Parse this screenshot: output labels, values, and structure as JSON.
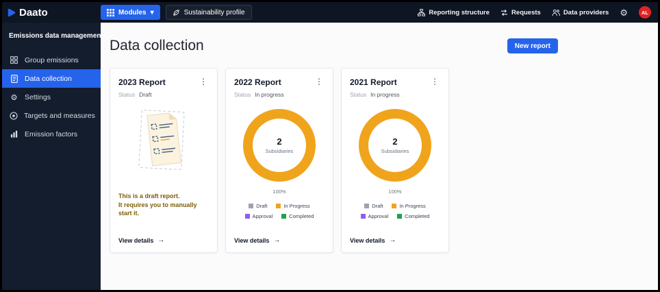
{
  "topbar": {
    "logo_text": "Daato",
    "modules_label": "Modules",
    "sustainability_label": "Sustainability profile",
    "nav": [
      {
        "label": "Reporting structure"
      },
      {
        "label": "Requests"
      },
      {
        "label": "Data providers"
      }
    ],
    "avatar_initials": "AL"
  },
  "sidebar": {
    "title": "Emissions data management",
    "items": [
      {
        "label": "Group emissions",
        "active": false
      },
      {
        "label": "Data collection",
        "active": true
      },
      {
        "label": "Settings",
        "active": false
      },
      {
        "label": "Targets and measures",
        "active": false
      },
      {
        "label": "Emission factors",
        "active": false
      }
    ]
  },
  "main": {
    "title": "Data collection",
    "new_report_label": "New report",
    "cards": [
      {
        "title": "2023 Report",
        "status_label": "Status",
        "status_value": "Draft",
        "message_line1": "This is a draft report.",
        "message_line2": "It requires you to manually start it.",
        "view_details_label": "View details"
      },
      {
        "title": "2022 Report",
        "status_label": "Status",
        "status_value": "In progress",
        "donut_count": "2",
        "donut_label": "Subsidiaries",
        "percent": "100%",
        "legend": [
          {
            "label": "Draft",
            "color": "#9ca3af"
          },
          {
            "label": "In Progress",
            "color": "#f0a41c"
          },
          {
            "label": "Approval",
            "color": "#8b5cf6"
          },
          {
            "label": "Completed",
            "color": "#21a04c"
          }
        ],
        "view_details_label": "View details"
      },
      {
        "title": "2021 Report",
        "status_label": "Status",
        "status_value": "In progress",
        "donut_count": "2",
        "donut_label": "Subsidiaries",
        "percent": "100%",
        "legend": [
          {
            "label": "Draft",
            "color": "#9ca3af"
          },
          {
            "label": "In Progress",
            "color": "#f0a41c"
          },
          {
            "label": "Approval",
            "color": "#8b5cf6"
          },
          {
            "label": "Completed",
            "color": "#21a04c"
          }
        ],
        "view_details_label": "View details"
      }
    ]
  },
  "icons": {
    "kebab": "⋮",
    "arrow_right": "→",
    "gear": "⚙",
    "chevron_down": "▾"
  },
  "colors": {
    "accent": "#2563eb",
    "topbar_bg": "#0e1523",
    "sidebar_bg": "#141d2e",
    "donut": "#f0a41c",
    "avatar_bg": "#e02424",
    "draft_text": "#7d5e09"
  }
}
